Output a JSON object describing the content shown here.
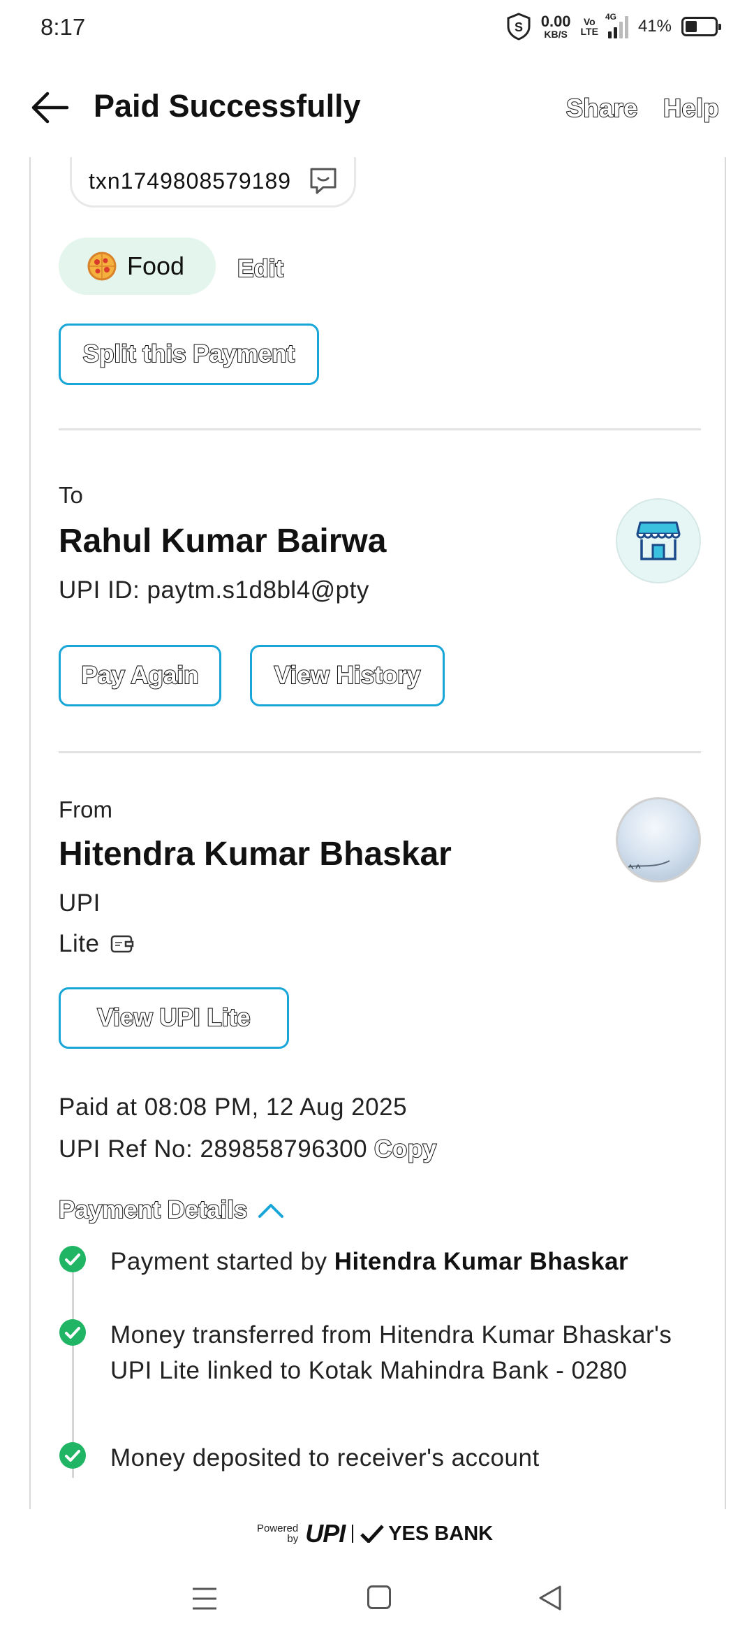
{
  "status_bar": {
    "time": "8:17",
    "net_speed_value": "0.00",
    "net_speed_unit": "KB/S",
    "volte": "Vo\nLTE",
    "network": "4G",
    "battery": "41%"
  },
  "header": {
    "title": "Paid Successfully",
    "share_label": "Share",
    "help_label": "Help"
  },
  "transaction": {
    "id": "txn1749808579189"
  },
  "category": {
    "label": "Food",
    "edit_label": "Edit"
  },
  "split_button": "Split this Payment",
  "to": {
    "label": "To",
    "name": "Rahul Kumar Bairwa",
    "upi_id": "UPI ID: paytm.s1d8bl4@pty",
    "pay_again_label": "Pay Again",
    "history_label": "View History"
  },
  "from": {
    "label": "From",
    "name": "Hitendra Kumar Bhaskar",
    "method_line1": "UPI",
    "method_line2": "Lite",
    "view_lite_label": "View UPI Lite"
  },
  "payment_info": {
    "paid_at": "Paid at 08:08 PM, 12 Aug 2025",
    "ref_no": "UPI Ref No: 289858796300",
    "copy_label": "Copy"
  },
  "payment_details": {
    "title": "Payment Details",
    "steps": [
      {
        "prefix": "Payment started by ",
        "bold": "Hitendra Kumar Bhaskar"
      },
      {
        "text": "Money transferred from Hitendra Kumar Bhaskar's UPI Lite linked to Kotak Mahindra Bank - 0280"
      },
      {
        "text": "Money deposited to receiver's account"
      }
    ]
  },
  "footer": {
    "powered": "Powered",
    "by": "by",
    "upi": "UPI",
    "bank": "YES BANK"
  },
  "colors": {
    "accent": "#18a6d9",
    "success": "#1fb564",
    "chip_bg": "#e3f5ec"
  }
}
